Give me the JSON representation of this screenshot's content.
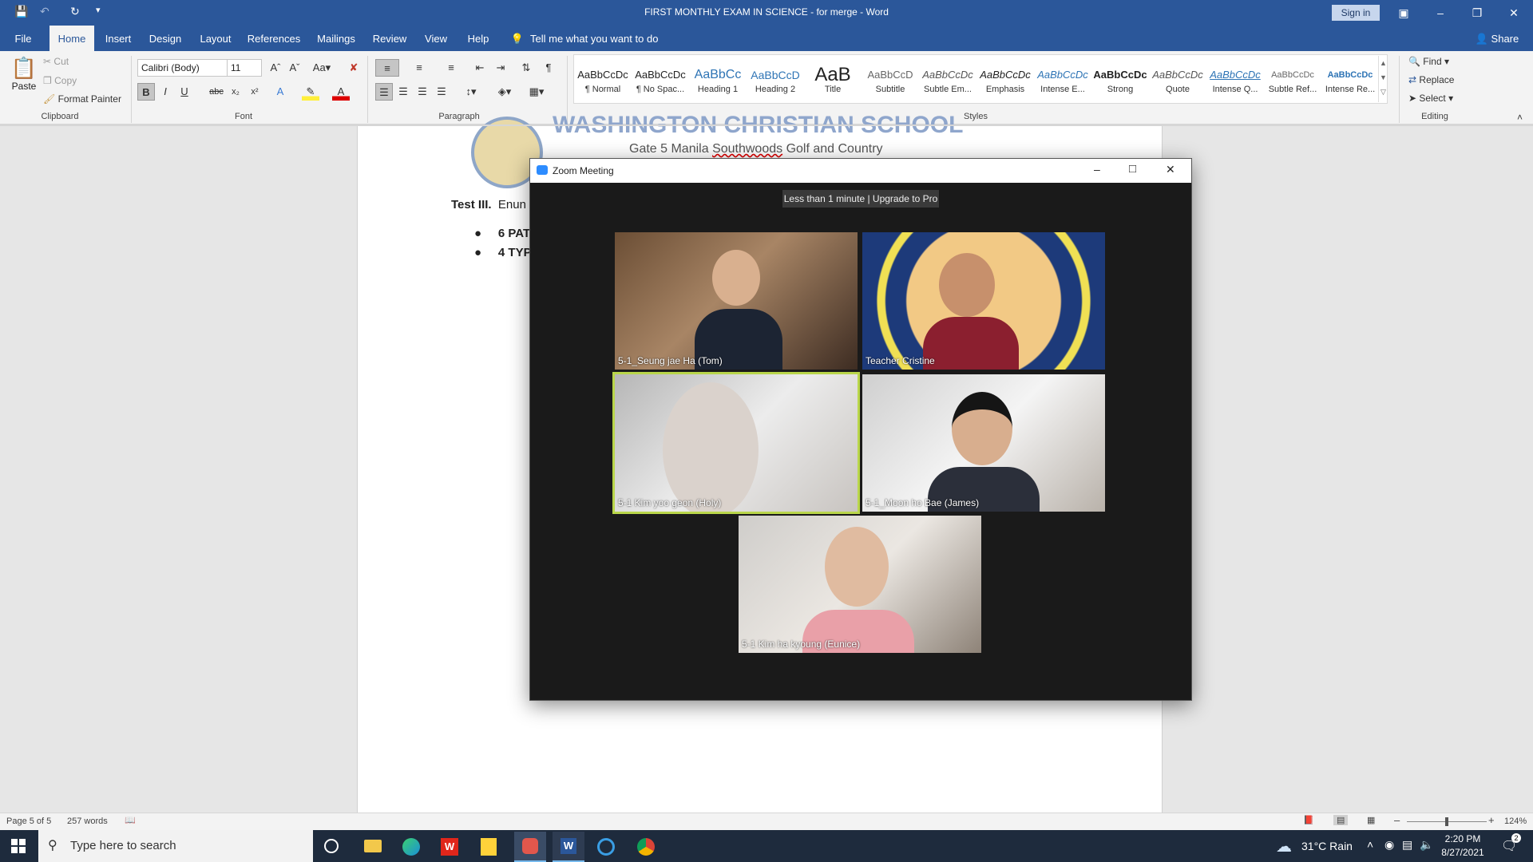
{
  "window": {
    "title": "FIRST MONTHLY EXAM IN SCIENCE - for merge - Word",
    "sign_in": "Sign in",
    "share": "Share"
  },
  "tabs": [
    "File",
    "Home",
    "Insert",
    "Design",
    "Layout",
    "References",
    "Mailings",
    "Review",
    "View",
    "Help"
  ],
  "tell_me": "Tell me what you want to do",
  "clipboard": {
    "paste": "Paste",
    "cut": "Cut",
    "copy": "Copy",
    "format_painter": "Format Painter",
    "label": "Clipboard"
  },
  "font": {
    "name": "Calibri (Body)",
    "size": "11",
    "label": "Font"
  },
  "paragraph": {
    "label": "Paragraph"
  },
  "styles": {
    "label": "Styles",
    "items": [
      {
        "preview": "AaBbCcDc",
        "name": "¶ Normal"
      },
      {
        "preview": "AaBbCcDc",
        "name": "¶ No Spac..."
      },
      {
        "preview": "AaBbCc",
        "name": "Heading 1"
      },
      {
        "preview": "AaBbCcD",
        "name": "Heading 2"
      },
      {
        "preview": "AaB",
        "name": "Title"
      },
      {
        "preview": "AaBbCcD",
        "name": "Subtitle"
      },
      {
        "preview": "AaBbCcDc",
        "name": "Subtle Em..."
      },
      {
        "preview": "AaBbCcDc",
        "name": "Emphasis"
      },
      {
        "preview": "AaBbCcDc",
        "name": "Intense E..."
      },
      {
        "preview": "AaBbCcDc",
        "name": "Strong"
      },
      {
        "preview": "AaBbCcDc",
        "name": "Quote"
      },
      {
        "preview": "AaBbCcDc",
        "name": "Intense Q..."
      },
      {
        "preview": "AaBbCcDc",
        "name": "Subtle Ref..."
      },
      {
        "preview": "AaBbCcDc",
        "name": "Intense Re..."
      }
    ]
  },
  "editing": {
    "find": "Find",
    "replace": "Replace",
    "select": "Select",
    "label": "Editing"
  },
  "document": {
    "school": "WASHINGTON CHRISTIAN SCHOOL",
    "address_pre": "Gate 5 Manila ",
    "address_err": "Southwoods",
    "address_post": " Golf and Country",
    "test_label": "Test III.",
    "test_text": "Enun",
    "bullets": [
      "6 PAT",
      "4 TYP"
    ]
  },
  "zoom": {
    "title": "Zoom Meeting",
    "banner": "Less than 1 minute | Upgrade to Pro",
    "participants": [
      "5-1_Seung jae Ha (Tom)",
      "Teacher Cristine",
      "5-1 Kim yoo geon (Holy)",
      "5-1_Moon ho Bae (James)",
      "5-1 Kim ha kyoung (Eunice)"
    ]
  },
  "status": {
    "page": "Page 5 of 5",
    "words": "257 words",
    "zoom": "124%"
  },
  "taskbar": {
    "search_placeholder": "Type here to search",
    "weather": "31°C  Rain",
    "time": "2:20 PM",
    "date": "8/27/2021",
    "notif": "2"
  },
  "colors": {
    "word_blue": "#2b579a",
    "zoom_bg": "#1a1a1a",
    "active_speaker": "#b9d64a"
  }
}
